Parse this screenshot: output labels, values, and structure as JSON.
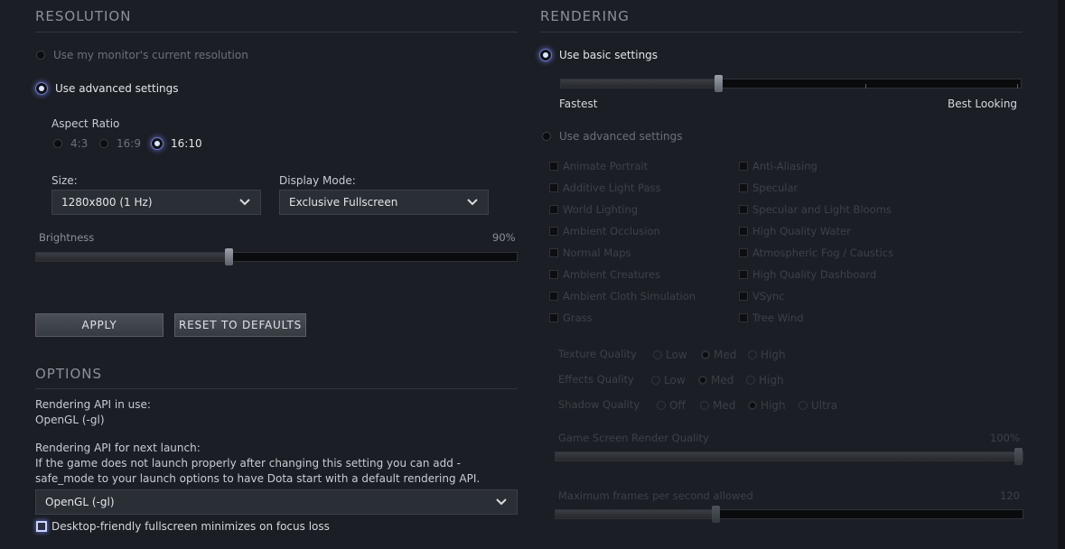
{
  "resolution": {
    "title": "RESOLUTION",
    "use_monitor": "Use my monitor's current resolution",
    "use_advanced": "Use advanced settings",
    "aspect_label": "Aspect Ratio",
    "aspect_options": [
      "4:3",
      "16:9",
      "16:10"
    ],
    "aspect_selected": "16:10",
    "size_label": "Size:",
    "size_value": "1280x800 (1 Hz)",
    "display_mode_label": "Display Mode:",
    "display_mode_value": "Exclusive Fullscreen",
    "brightness_label": "Brightness",
    "brightness_value": "90%",
    "brightness_level": 0.4,
    "apply": "APPLY",
    "reset": "RESET TO DEFAULTS"
  },
  "options": {
    "title": "OPTIONS",
    "api_in_use_label": "Rendering API in use:",
    "api_in_use_value": "OpenGL (-gl)",
    "api_next_label": "Rendering API for next launch:",
    "api_note_1": "If the game does not launch properly after changing this setting you can add -",
    "api_note_2": "safe_mode to your launch options to have Dota start with a default rendering API.",
    "api_next_value": "OpenGL (-gl)",
    "desktop_friendly": "Desktop-friendly fullscreen minimizes on focus loss"
  },
  "rendering": {
    "title": "RENDERING",
    "use_basic": "Use basic settings",
    "fastest": "Fastest",
    "best_looking": "Best Looking",
    "basic_level": 0.34,
    "use_advanced": "Use advanced settings",
    "checks_left": [
      "Animate Portrait",
      "Additive Light Pass",
      "World Lighting",
      "Ambient Occlusion",
      "Normal Maps",
      "Ambient Creatures",
      "Ambient Cloth Simulation",
      "Grass"
    ],
    "checks_right": [
      "Anti-Aliasing",
      "Specular",
      "Specular and Light Blooms",
      "High Quality Water",
      "Atmospheric Fog / Caustics",
      "High Quality Dashboard",
      "VSync",
      "Tree Wind"
    ],
    "texture_label": "Texture Quality",
    "texture_options": [
      "Low",
      "Med",
      "High"
    ],
    "effects_label": "Effects Quality",
    "effects_options": [
      "Low",
      "Med",
      "High"
    ],
    "shadow_label": "Shadow Quality",
    "shadow_options": [
      "Off",
      "Med",
      "High",
      "Ultra"
    ],
    "render_quality_label": "Game Screen Render Quality",
    "render_quality_value": "100%",
    "render_quality_level": 1.0,
    "max_fps_label": "Maximum frames per second allowed",
    "max_fps_value": "120",
    "max_fps_level": 0.34
  },
  "colors": {
    "background": "#1b1e24",
    "accent_glow": "#6f79c8"
  }
}
